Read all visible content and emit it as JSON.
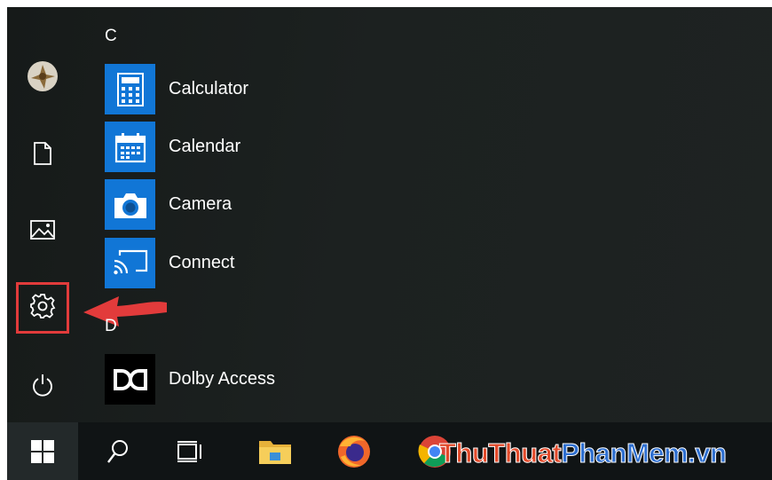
{
  "start_menu": {
    "groups": [
      {
        "letter": "C",
        "apps": [
          "Calculator",
          "Calendar",
          "Camera",
          "Connect"
        ]
      },
      {
        "letter": "D",
        "apps": [
          "Dolby Access"
        ]
      }
    ]
  },
  "colors": {
    "tile_blue": "#1176d6",
    "highlight_red": "#e23b3b",
    "menu_bg": "#1c2120",
    "taskbar_bg": "#101415"
  },
  "rail_icons": [
    "user-avatar",
    "documents-icon",
    "pictures-icon",
    "settings-icon",
    "power-icon"
  ],
  "taskbar_icons": [
    "windows-start-icon",
    "search-icon",
    "task-view-icon",
    "file-explorer-icon",
    "firefox-icon",
    "chrome-icon"
  ],
  "watermark": {
    "part1": "ThuThuat",
    "part2": "PhanMem.vn"
  }
}
